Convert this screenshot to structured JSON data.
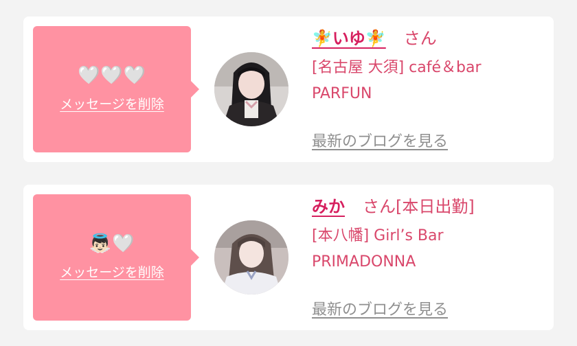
{
  "cards": [
    {
      "emojis": "🤍🤍🤍",
      "delete_label": "メッセージを削除",
      "name": "🧚いゆ🧚",
      "suffix": "さん",
      "shop_line1": "[名古屋 大須] café＆bar",
      "shop_line2": "PARFUN",
      "blog_label": "最新のブログを見る"
    },
    {
      "emojis": "👼🏻🤍",
      "delete_label": "メッセージを削除",
      "name": "みか",
      "suffix": "さん[本日出勤]",
      "shop_line1": "[本八幡] Girl’s Bar",
      "shop_line2": "PRIMADONNA",
      "blog_label": "最新のブログを見る"
    }
  ],
  "colors": {
    "accent_pink": "#ff92a2",
    "name_pink": "#d61f5e",
    "text_pink": "#d9476b",
    "link_gray": "#8f8f8f"
  }
}
